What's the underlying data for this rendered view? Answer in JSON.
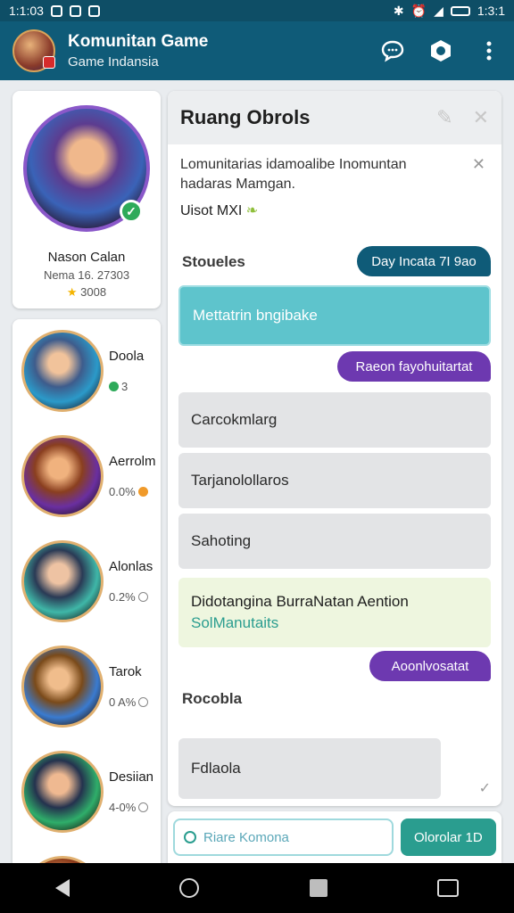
{
  "status_bar": {
    "time": "1:1:03",
    "right_time": "1:3:1"
  },
  "app_bar": {
    "title": "Komunitan Game",
    "subtitle": "Game Indansia",
    "actions": [
      "chat-icon",
      "settings-icon",
      "more-vert-icon"
    ]
  },
  "profile": {
    "name": "Nason Calan",
    "meta": "Nema 16. 27303",
    "stats": "3008",
    "star_color": "#f4b400"
  },
  "friends": [
    {
      "name": "Doola",
      "stat": "3",
      "stat_icon": "green-dot"
    },
    {
      "name": "Aerrolm",
      "stat": "0.0%",
      "stat_icon": "orange-coin"
    },
    {
      "name": "Alonlas",
      "stat": "0.2%",
      "stat_icon": "info"
    },
    {
      "name": "Tarok",
      "stat": "0 A%",
      "stat_icon": "info"
    },
    {
      "name": "Desiian",
      "stat": "4-0%",
      "stat_icon": "info"
    }
  ],
  "chat": {
    "title": "Ruang Obrols",
    "description": "Lomunitarias idamoalibe Inomuntan hadaras Mamgan.",
    "user": "Uisot MXI",
    "section1": "Stoueles",
    "pill1": "Day Incata 7I 9ao",
    "active_msg": "Mettatrin bngibake",
    "pill2": "Raeon fayohuitartat",
    "msgs": [
      "Carcokmlarg",
      "Tarjanolollaros",
      "Sahoting"
    ],
    "green_msg": {
      "line1": "Didotangina BurraNatan Aention",
      "line2": "SolManutaits"
    },
    "pill3": "Aoonlvosatat",
    "section2": "Rocobla",
    "last_msg": "Fdlaola"
  },
  "composer": {
    "placeholder": "Riare Komona",
    "send_label": "Olorolar 1D"
  },
  "colors": {
    "primary": "#0f5b78",
    "accent_teal": "#5ec4cc",
    "accent_purple": "#6d39b0",
    "send_green": "#2a9d8f"
  }
}
